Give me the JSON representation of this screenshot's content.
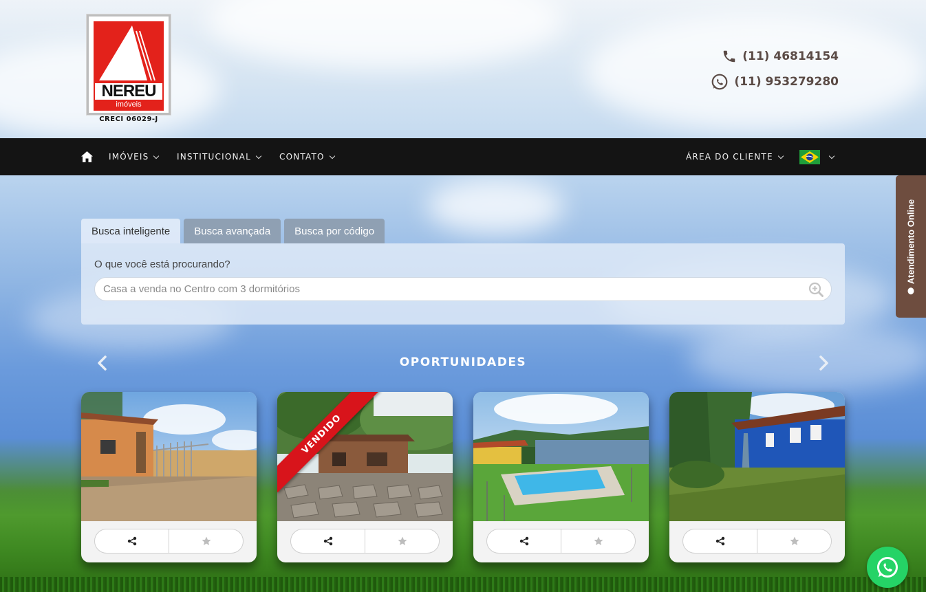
{
  "header": {
    "logo": {
      "brand": "NEREU",
      "sub": "imóveis"
    },
    "creci": "CRECI 06029-J",
    "phones": [
      {
        "icon": "phone-icon",
        "number": "(11) 46814154"
      },
      {
        "icon": "whatsapp-icon",
        "number": "(11) 953279280"
      }
    ]
  },
  "nav": {
    "home_icon": "home-icon",
    "items": [
      {
        "label": "IMÓVEIS"
      },
      {
        "label": "INSTITUCIONAL"
      },
      {
        "label": "CONTATO"
      }
    ],
    "client_area": "ÁREA DO CLIENTE",
    "language_flag": "brazil-flag-icon"
  },
  "atendimento": {
    "label": "Atendimento Online"
  },
  "search": {
    "tabs": [
      {
        "label": "Busca inteligente",
        "active": true
      },
      {
        "label": "Busca avançada",
        "active": false
      },
      {
        "label": "Busca por código",
        "active": false
      }
    ],
    "question": "O que você está procurando?",
    "placeholder": "Casa a venda no Centro com 3 dormitórios"
  },
  "opportunities": {
    "title": "OPORTUNIDADES",
    "cards": [
      {
        "photo": "gate-and-dirt-road",
        "ribbon": ""
      },
      {
        "photo": "brick-house-with-paved-yard",
        "ribbon": "VENDIDO"
      },
      {
        "photo": "pool-and-lake-view",
        "ribbon": ""
      },
      {
        "photo": "blue-house-with-garden",
        "ribbon": ""
      }
    ]
  },
  "colors": {
    "navbar": "#141414",
    "ribbon": "#d8141b",
    "atendimento": "#6e4d3f",
    "whatsapp": "#25d366",
    "phone_text": "#5a4a45"
  }
}
